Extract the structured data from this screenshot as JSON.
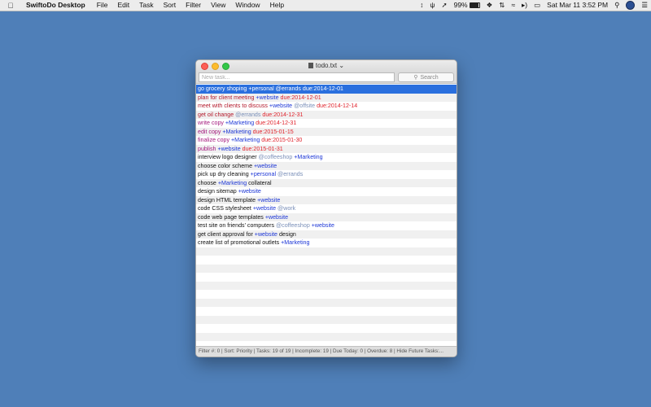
{
  "menubar": {
    "apple_icon": "apple-logo",
    "app_name": "SwiftoDo Desktop",
    "menus": [
      "File",
      "Edit",
      "Task",
      "Sort",
      "Filter",
      "View",
      "Window",
      "Help"
    ],
    "battery_percent": "99%",
    "battery_level": 0.99,
    "datetime": "Sat Mar 11  3:52 PM"
  },
  "window": {
    "title": "todo.txt",
    "new_task_placeholder": "New task...",
    "search_placeholder": "Search",
    "status": "Filter #: 0 | Sort: Priority | Tasks: 19 of 19 | Incomplete: 19 | Due Today: 0 | Overdue: 8 | Hide Future Tasks:..."
  },
  "colors": {
    "desktop": "#4f7fb8",
    "selection": "#2a6fde",
    "priority_a": "#b3182a",
    "priority_b": "#a4187d",
    "due": "#e0232c",
    "project": "#1c36d6",
    "context": "#7a8fb8"
  },
  "tasks": [
    {
      "selected": true,
      "parts": [
        {
          "text": "go grocery shoping ",
          "kind": "text"
        },
        {
          "text": "+personal",
          "kind": "project"
        },
        {
          "text": " @errands",
          "kind": "context"
        },
        {
          "text": " due:2014-12-01",
          "kind": "due"
        }
      ]
    },
    {
      "cls": "t-red",
      "parts": [
        {
          "text": "plan for client meeting ",
          "kind": "text"
        },
        {
          "text": "+website",
          "kind": "project"
        },
        {
          "text": " due:2014-12-01",
          "kind": "due"
        }
      ]
    },
    {
      "cls": "t-red",
      "parts": [
        {
          "text": "meet with clients to discuss ",
          "kind": "text"
        },
        {
          "text": "+website",
          "kind": "project"
        },
        {
          "text": " @offsite",
          "kind": "context"
        },
        {
          "text": " due:2014-12-14",
          "kind": "due"
        }
      ]
    },
    {
      "cls": "t-red",
      "parts": [
        {
          "text": "get oil change ",
          "kind": "text"
        },
        {
          "text": "@errands",
          "kind": "context"
        },
        {
          "text": " due:2014-12-31",
          "kind": "due"
        }
      ]
    },
    {
      "cls": "t-purple",
      "parts": [
        {
          "text": "write copy ",
          "kind": "text"
        },
        {
          "text": "+Marketing",
          "kind": "project"
        },
        {
          "text": " due:2014-12-31",
          "kind": "due"
        }
      ]
    },
    {
      "cls": "t-purple",
      "parts": [
        {
          "text": "edit copy ",
          "kind": "text"
        },
        {
          "text": "+Marketing",
          "kind": "project"
        },
        {
          "text": " due:2015-01-15",
          "kind": "due"
        }
      ]
    },
    {
      "cls": "t-purple",
      "parts": [
        {
          "text": "finalize copy ",
          "kind": "text"
        },
        {
          "text": "+Marketing",
          "kind": "project"
        },
        {
          "text": " due:2015-01-30",
          "kind": "due"
        }
      ]
    },
    {
      "cls": "t-purple",
      "parts": [
        {
          "text": "publish ",
          "kind": "text"
        },
        {
          "text": "+website",
          "kind": "project"
        },
        {
          "text": " due:2015-01-31",
          "kind": "due"
        }
      ]
    },
    {
      "parts": [
        {
          "text": "interview logo designer ",
          "kind": "text"
        },
        {
          "text": "@coffeeshop",
          "kind": "context"
        },
        {
          "text": " +Marketing",
          "kind": "project"
        }
      ]
    },
    {
      "parts": [
        {
          "text": "choose color scheme ",
          "kind": "text"
        },
        {
          "text": "+website",
          "kind": "project"
        }
      ]
    },
    {
      "parts": [
        {
          "text": "pick up dry cleaning ",
          "kind": "text"
        },
        {
          "text": "+personal",
          "kind": "project"
        },
        {
          "text": " @errands",
          "kind": "context"
        }
      ]
    },
    {
      "parts": [
        {
          "text": "choose ",
          "kind": "text"
        },
        {
          "text": "+Marketing",
          "kind": "project"
        },
        {
          "text": " collateral",
          "kind": "text"
        }
      ]
    },
    {
      "parts": [
        {
          "text": "design sitemap ",
          "kind": "text"
        },
        {
          "text": "+website",
          "kind": "project"
        }
      ]
    },
    {
      "parts": [
        {
          "text": "design HTML template ",
          "kind": "text"
        },
        {
          "text": "+website",
          "kind": "project"
        }
      ]
    },
    {
      "parts": [
        {
          "text": "code CSS stylesheet ",
          "kind": "text"
        },
        {
          "text": "+website",
          "kind": "project"
        },
        {
          "text": " @work",
          "kind": "context"
        }
      ]
    },
    {
      "parts": [
        {
          "text": "code web page templates ",
          "kind": "text"
        },
        {
          "text": "+website",
          "kind": "project"
        }
      ]
    },
    {
      "parts": [
        {
          "text": "test site on friends' computers ",
          "kind": "text"
        },
        {
          "text": "@coffeeshop",
          "kind": "context"
        },
        {
          "text": " +website",
          "kind": "project"
        }
      ]
    },
    {
      "parts": [
        {
          "text": "get client approval for ",
          "kind": "text"
        },
        {
          "text": "+website",
          "kind": "project"
        },
        {
          "text": " design",
          "kind": "text"
        }
      ]
    },
    {
      "parts": [
        {
          "text": "create list of promotional outlets ",
          "kind": "text"
        },
        {
          "text": "+Marketing",
          "kind": "project"
        }
      ]
    }
  ]
}
